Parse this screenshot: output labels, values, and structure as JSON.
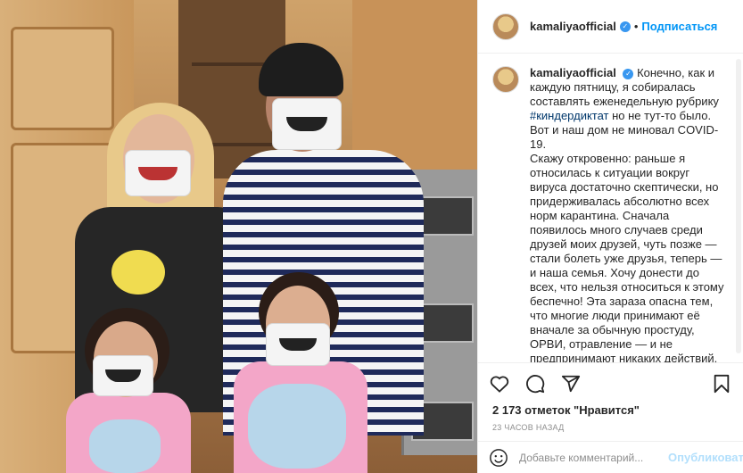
{
  "header": {
    "username": "kamaliyaofficial",
    "separator": "•",
    "follow_label": "Подписаться"
  },
  "caption": {
    "username": "kamaliyaofficial",
    "text_before_tag": "Конечно, как и каждую пятницу, я собиралась составлять еженедельную рубрику ",
    "hashtag": "#киндердиктат",
    "text_after_tag": " но не тут-то было. Вот и наш дом не миновал COVID-19.\nСкажу откровенно: раньше я относилась к ситуации вокруг вируса достаточно скептически, но придерживалась абсолютно всех норм карантина. Сначала появилось много случаев среди друзей моих друзей, чуть позже — стали болеть уже друзья, теперь — и наша семья. Хочу донести до всех, что нельзя относиться к этому беспечно! Эта зараза опасна тем, что многие люди принимают её вначале за обычную простуду, ОРВИ, отравление — и не предпринимают никаких действий."
  },
  "likes_text": "2 173 отметок \"Нравится\"",
  "timestamp": "23 ЧАСОВ НАЗАД",
  "comment": {
    "placeholder": "Добавьте комментарий...",
    "publish_label": "Опубликовать"
  },
  "icons": {
    "like": "heart-icon",
    "comment": "comment-icon",
    "share": "share-icon",
    "save": "bookmark-icon",
    "emoji": "emoji-icon",
    "verified": "verified-badge-icon"
  },
  "colors": {
    "accent": "#0095f6",
    "hashtag": "#00376b",
    "muted": "#8e8e8e",
    "publish_disabled": "#b2dffc"
  }
}
